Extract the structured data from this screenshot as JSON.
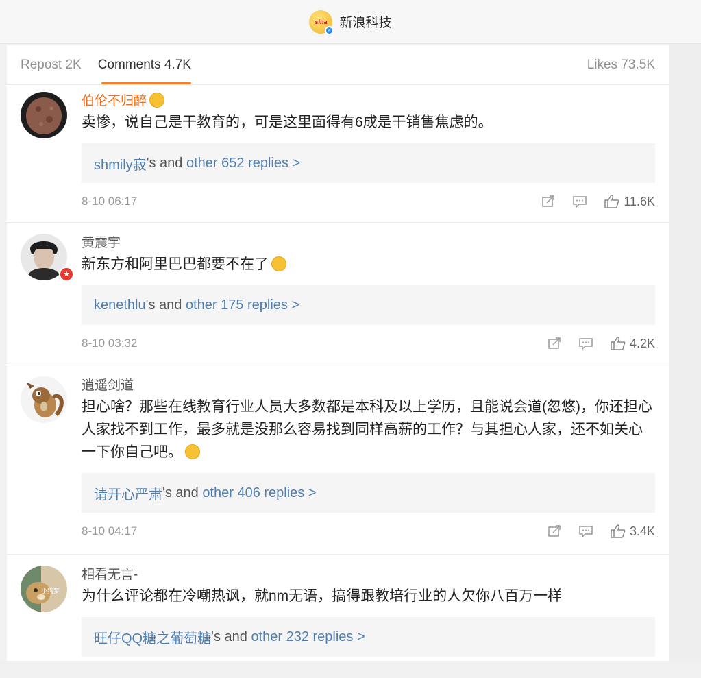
{
  "header": {
    "account_name": "新浪科技",
    "logo_text": "sina",
    "verified_icon": "verified-badge-icon"
  },
  "tabs": {
    "repost": "Repost 2K",
    "comments": "Comments 4.7K",
    "likes": "Likes 73.5K",
    "accent": "#f5802b"
  },
  "comments": [
    {
      "name": "伯伦不归醉",
      "text": "卖惨，说自己是干教育的，可是这里面得有6成是干销售焦虑的。",
      "reply_user": "shmily寂",
      "reply_mid": "'s and ",
      "reply_more": "other 652 replies >",
      "time": "8-10 06:17",
      "likes": "11.6K"
    },
    {
      "name": "黄震宇",
      "text": "新东方和阿里巴巴都要不在了",
      "reply_user": "kenethlu",
      "reply_mid": "'s and ",
      "reply_more": "other 175 replies >",
      "time": "8-10 03:32",
      "likes": "4.2K"
    },
    {
      "name": "逍遥剑道",
      "text": "担心啥？那些在线教育行业人员大多数都是本科及以上学历，且能说会道(忽悠)，你还担心人家找不到工作，最多就是没那么容易找到同样高薪的工作？与其担心人家，还不如关心一下你自己吧。",
      "reply_user": "请开心严肃",
      "reply_mid": "'s and ",
      "reply_more": "other 406 replies >",
      "time": "8-10 04:17",
      "likes": "3.4K"
    },
    {
      "name": "相看无言-",
      "text": "为什么评论都在冷嘲热讽，就nm无语，搞得跟教培行业的人欠你八百万一样",
      "reply_user": "旺仔QQ糖之葡萄糖",
      "reply_mid": "'s and ",
      "reply_more": "other 232 replies >",
      "avatar_text": "小狗梦"
    }
  ],
  "colors": {
    "name_highlight": "#ef6b1a",
    "link": "#507daf"
  }
}
